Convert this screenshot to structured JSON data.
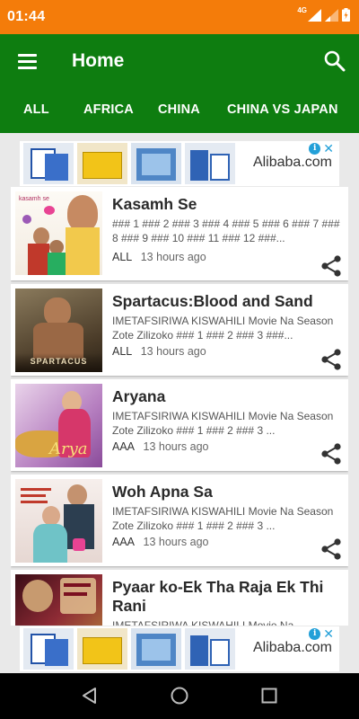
{
  "status_bar": {
    "time": "01:44",
    "network": "4G"
  },
  "app_bar": {
    "title": "Home"
  },
  "tabs": [
    {
      "label": "ALL"
    },
    {
      "label": "AFRICA"
    },
    {
      "label": "CHINA"
    },
    {
      "label": "CHINA VS JAPAN"
    }
  ],
  "ads": [
    {
      "text": "Alibaba.com"
    },
    {
      "text": "Alibaba.com"
    }
  ],
  "posts": [
    {
      "title": "Kasamh Se",
      "snippet": "### 1 ### 2 ### 3 ### 4 ### 5 ### 6 ### 7 ### 8 ### 9 ### 10 ### 11 ### 12 ###...",
      "category": "ALL",
      "time_ago": "13 hours ago",
      "thumb_caption": "kasamh se"
    },
    {
      "title": "Spartacus:Blood and Sand",
      "snippet": "IMETAFSIRIWA KISWAHILI Movie Na Season Zote Zilizoko ### 1 ### 2 ### 3 ###...",
      "category": "ALL",
      "time_ago": "13 hours ago",
      "thumb_caption": "SPARTACUS"
    },
    {
      "title": "Aryana",
      "snippet": "IMETAFSIRIWA KISWAHILI Movie Na Season Zote Zilizoko ### 1 ### 2 ### 3 ...",
      "category": "AAA",
      "time_ago": "13 hours ago",
      "thumb_caption": "Arya"
    },
    {
      "title": "Woh Apna Sa",
      "snippet": "IMETAFSIRIWA KISWAHILI Movie Na Season Zote Zilizoko ### 1 ### 2 ### 3 ...",
      "category": "AAA",
      "time_ago": "13 hours ago",
      "thumb_caption": ""
    },
    {
      "title": "Pyaar ko-Ek Tha Raja Ek Thi Rani",
      "snippet": "IMETAFSIRIWA KISWAHILI Movie Na",
      "category": "",
      "time_ago": "",
      "thumb_caption": ""
    }
  ],
  "colors": {
    "status_bar": "#f47c0a",
    "app_bar": "#0e7d10",
    "ad_accent": "#23a0d8"
  },
  "icons": [
    "menu-icon",
    "search-icon",
    "share-icon",
    "back-icon",
    "home-icon",
    "recents-icon",
    "ad-info-icon",
    "ad-close-icon"
  ]
}
